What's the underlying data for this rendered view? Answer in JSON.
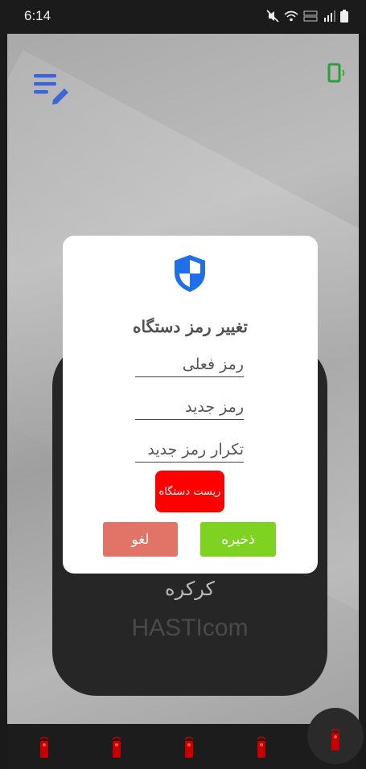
{
  "status_bar": {
    "time": "6:14",
    "icons": [
      "mute-icon",
      "wifi-icon",
      "volte-icon",
      "signal-icon",
      "battery-icon"
    ]
  },
  "toolbar": {
    "menu_icon": "edit-list-icon",
    "device_icon": "phone-vibrate-icon"
  },
  "device_card": {
    "label": "کرکره",
    "brand": "HASTIcom"
  },
  "dialog": {
    "icon": "shield-icon",
    "title": "تغییر رمز دستگاه",
    "fields": [
      {
        "placeholder": "رمز فعلی",
        "value": ""
      },
      {
        "placeholder": "رمز جدید",
        "value": ""
      },
      {
        "placeholder": "تکرار رمز جدید",
        "value": ""
      }
    ],
    "reset_label": "ریست دستگاه",
    "cancel_label": "لغو",
    "save_label": "ذخیره"
  },
  "bottom_nav": {
    "items": [
      "remote-icon",
      "remote-icon",
      "remote-icon",
      "remote-icon"
    ],
    "active_item": "remote-icon"
  },
  "colors": {
    "accent": "#3f66d6",
    "reset": "#ff0000",
    "cancel": "#e27467",
    "save": "#7ed321",
    "remote": "#c40000"
  }
}
